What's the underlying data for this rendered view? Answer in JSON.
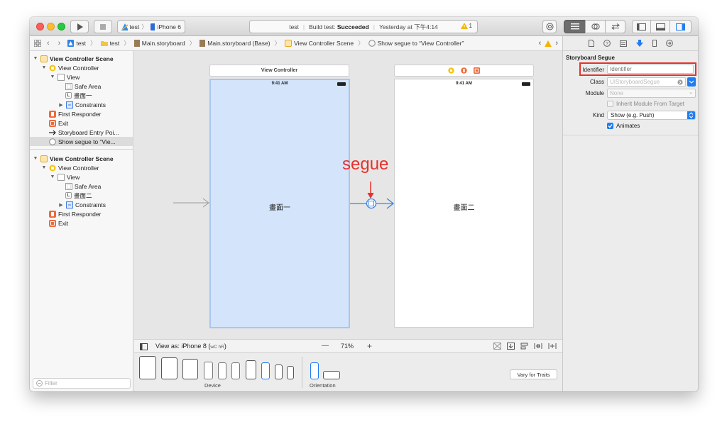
{
  "titlebar": {
    "scheme_project": "test",
    "scheme_device": "iPhone 6",
    "status_project": "test",
    "status_build_label": "Build test:",
    "status_build_result": "Succeeded",
    "status_time": "Yesterday at 下午4:14",
    "warning_count": "1"
  },
  "pathbar": {
    "items": [
      "test",
      "test",
      "Main.storyboard",
      "Main.storyboard (Base)",
      "View Controller Scene",
      "Show segue to “View Controller”"
    ]
  },
  "navigator": {
    "scene1": {
      "title": "View Controller Scene",
      "view_controller": "View Controller",
      "view": "View",
      "safe_area": "Safe Area",
      "label": "畫面一",
      "constraints": "Constraints",
      "first_responder": "First Responder",
      "exit": "Exit",
      "entry_point": "Storyboard Entry Poi...",
      "segue": "Show segue to “Vie..."
    },
    "scene2": {
      "title": "View Controller Scene",
      "view_controller": "View Controller",
      "view": "View",
      "safe_area": "Safe Area",
      "label": "畫面二",
      "constraints": "Constraints",
      "first_responder": "First Responder",
      "exit": "Exit"
    },
    "filter_placeholder": "Filter"
  },
  "canvas": {
    "vc1_header": "View Controller",
    "vc1_time": "9:41 AM",
    "vc1_label": "畫面一",
    "vc2_time": "9:41 AM",
    "vc2_label": "畫面二",
    "annotation": "segue",
    "annotation_color": "#e8302a"
  },
  "bottombar": {
    "view_as": "View as: iPhone 8 (",
    "view_as_traits": "wC hR",
    "view_as_end": ")",
    "zoom": "71%",
    "zoom_out": "—",
    "zoom_in": "+"
  },
  "devicebar": {
    "device_label": "Device",
    "orientation_label": "Orientation",
    "vary_button": "Vary for Traits"
  },
  "inspector": {
    "section_title": "Storyboard Segue",
    "identifier_label": "Identifier",
    "identifier_placeholder": "Identifier",
    "class_label": "Class",
    "class_placeholder": "UIStoryboardSegue",
    "module_label": "Module",
    "module_placeholder": "None",
    "inherit_label": "Inherit Module From Target",
    "kind_label": "Kind",
    "kind_value": "Show (e.g. Push)",
    "animates_label": "Animates",
    "highlight_color": "#e8302a",
    "accent_color": "#1f7cf2"
  }
}
